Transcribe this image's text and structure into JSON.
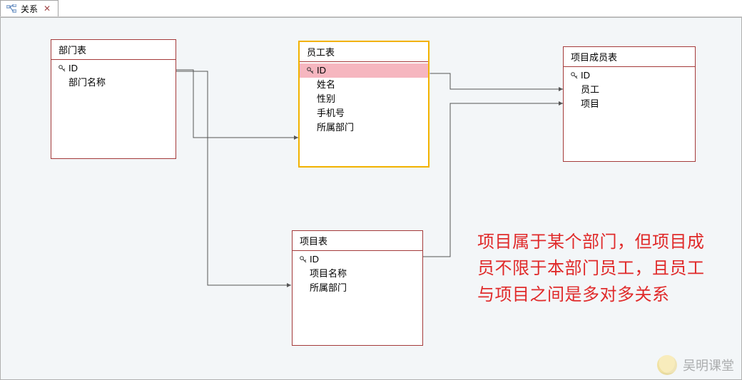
{
  "tab": {
    "label": "关系"
  },
  "tables": {
    "dept": {
      "title": "部门表",
      "fields": [
        {
          "name": "ID",
          "pk": true
        },
        {
          "name": "部门名称",
          "pk": false
        }
      ]
    },
    "employee": {
      "title": "员工表",
      "fields": [
        {
          "name": "ID",
          "pk": true
        },
        {
          "name": "姓名",
          "pk": false
        },
        {
          "name": "性别",
          "pk": false
        },
        {
          "name": "手机号",
          "pk": false
        },
        {
          "name": "所属部门",
          "pk": false
        }
      ]
    },
    "project_member": {
      "title": "项目成员表",
      "fields": [
        {
          "name": "ID",
          "pk": true
        },
        {
          "name": "员工",
          "pk": false
        },
        {
          "name": "项目",
          "pk": false
        }
      ]
    },
    "project": {
      "title": "项目表",
      "fields": [
        {
          "name": "ID",
          "pk": true
        },
        {
          "name": "项目名称",
          "pk": false
        },
        {
          "name": "所属部门",
          "pk": false
        }
      ]
    }
  },
  "annotation_text": "项目属于某个部门，但项目成员不限于本部门员工，且员工与项目之间是多对多关系",
  "watermark_text": "吴明课堂"
}
